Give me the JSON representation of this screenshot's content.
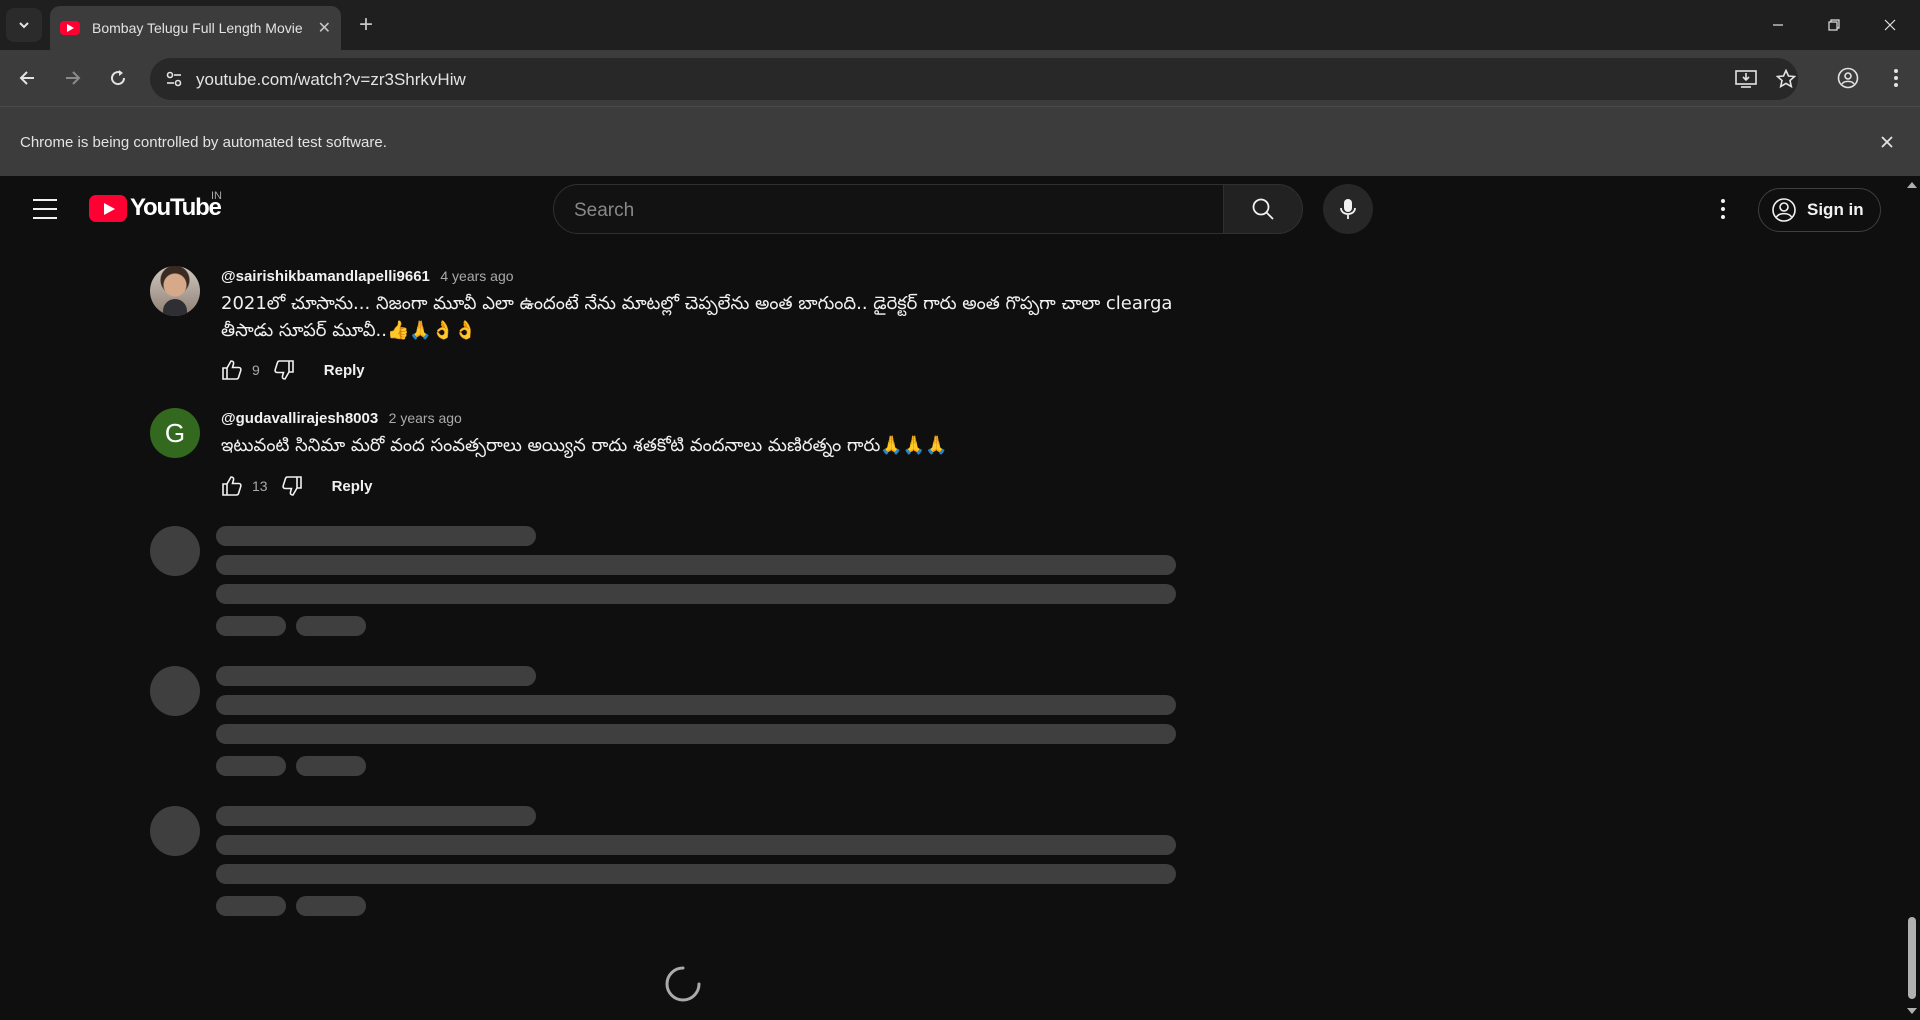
{
  "browser": {
    "tab_title": "Bombay Telugu Full Length Movie",
    "url": "youtube.com/watch?v=zr3ShrkvHiw",
    "infobar_text": "Chrome is being controlled by automated test software."
  },
  "youtube": {
    "logo_text": "YouTube",
    "region": "IN",
    "search_placeholder": "Search",
    "signin_label": "Sign in"
  },
  "comments": [
    {
      "author": "@sairishikbamandlapelli9661",
      "time": "4 years ago",
      "text": "2021లో చూసాను... నిజంగా మూవీ ఎలా ఉందంటే నేను మాటల్లో చెప్పలేను అంత బాగుంది.. డైరెక్టర్ గారు అంత గొప్పగా చాలా clearga తీసాడు సూపర్ మూవీ..👍🙏👌👌",
      "likes": "9",
      "reply_label": "Reply",
      "avatar_type": "photo"
    },
    {
      "author": "@gudavallirajesh8003",
      "time": "2 years ago",
      "text": "ఇటువంటి సినిమా మరో వంద సంవత్సరాలు అయ్యిన రాదు శతకోటి వందనాలు మణిరత్నం గారు🙏🙏🙏",
      "likes": "13",
      "reply_label": "Reply",
      "avatar_letter": "G",
      "avatar_color": "#33691e"
    }
  ],
  "colors": {
    "background": "#0f0f0f",
    "skeleton": "#3f3f3f",
    "brand_red": "#ff0033"
  }
}
